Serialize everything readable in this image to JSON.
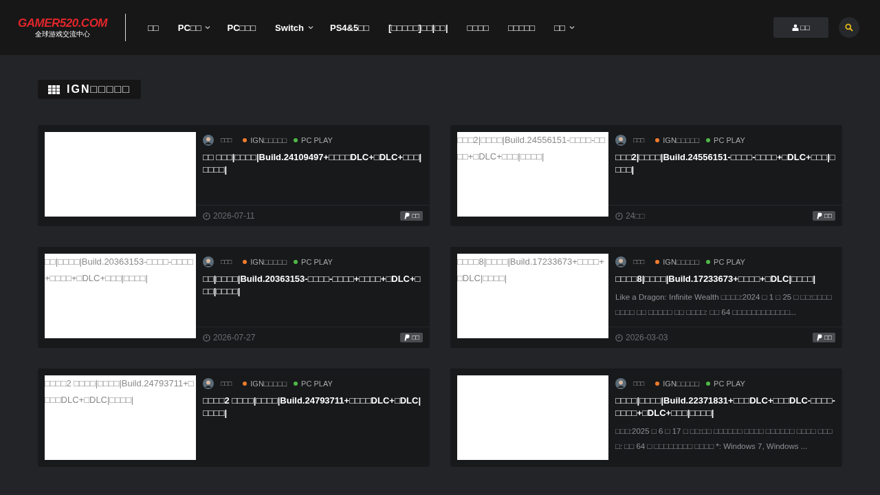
{
  "header": {
    "logo": {
      "main": "GAMER520.COM",
      "tagline": "全球游戏交流中心"
    },
    "nav": [
      {
        "label": "□□",
        "caret": false
      },
      {
        "label": "PC□□",
        "caret": true
      },
      {
        "label": "PC□□□",
        "caret": false
      },
      {
        "label": "Switch",
        "caret": true
      },
      {
        "label": "PS4&5□□",
        "caret": false
      },
      {
        "label": "[□□□□□]□□|□□|",
        "caret": false
      },
      {
        "label": "□□□□",
        "caret": false
      },
      {
        "label": "□□□□□",
        "caret": false
      },
      {
        "label": "□□",
        "caret": true
      }
    ],
    "login": "□□"
  },
  "section_title": "IGN□□□□□",
  "posts": [
    {
      "author": "□□□",
      "category": "IGN□□□□□",
      "platform": "PC PLAY",
      "title": "□□ □□□|□□□□|Build.24109497+□□□□DLC+□DLC+□□□|□□□□|",
      "date": "2026-07-11",
      "badge": "□□"
    },
    {
      "thumbnail_alt": "□□□2|□□□□|Build.24556151-□□□□-□□□□+□DLC+□□□|□□□□|",
      "author": "□□□",
      "category": "IGN□□□□□",
      "platform": "PC PLAY",
      "title": "□□□2|□□□□|Build.24556151-□□□□-□□□□+□DLC+□□□|□□□□|",
      "date": "24□□",
      "badge": "□□"
    },
    {
      "thumbnail_alt": "□□|□□□□|Build.20363153-□□□□-□□□□+□□□□+□DLC+□□□|□□□□|",
      "author": "□□□",
      "category": "IGN□□□□□",
      "platform": "PC PLAY",
      "title": "□□|□□□□|Build.20363153-□□□□-□□□□+□□□□+□DLC+□□□|□□□□|",
      "date": "2026-07-27",
      "badge": "□□"
    },
    {
      "thumbnail_alt": "□□□□8|□□□□|Build.17233673+□□□□+□DLC|□□□□|",
      "author": "□□□",
      "category": "IGN□□□□□",
      "platform": "PC PLAY",
      "title": "□□□□8|□□□□|Build.17233673+□□□□+□DLC|□□□□|",
      "excerpt": "Like a Dragon: Infinite Wealth □□□□:2024 □ 1 □ 25 □ □□:□□□□□□□□ □□ □□□□□ □□ □□□□: □□ 64 □□□□□□□□□□□□...",
      "date": "2026-03-03",
      "badge": "□□"
    },
    {
      "thumbnail_alt": "□□□□2 □□□□|□□□□|Build.24793711+□□□□DLC+□DLC|□□□□|",
      "author": "□□□",
      "category": "IGN□□□□□",
      "platform": "PC PLAY",
      "title": "□□□□2 □□□□|□□□□|Build.24793711+□□□□DLC+□DLC|□□□□|"
    },
    {
      "author": "□□□",
      "category": "IGN□□□□□",
      "platform": "PC PLAY",
      "title": "□□□□|□□□□|Build.22371831+□□□DLC+□□□DLC-□□□□-□□□□+□DLC+□□□|□□□□|",
      "excerpt": "□□□:2025 □ 6 □ 17 □ □□:□□ □□□□□□ □□□□ □□□□□□ □□□□ □□□□: □□ 64 □ □□□□□□□□ □□□□ *: Windows 7, Windows ..."
    }
  ]
}
